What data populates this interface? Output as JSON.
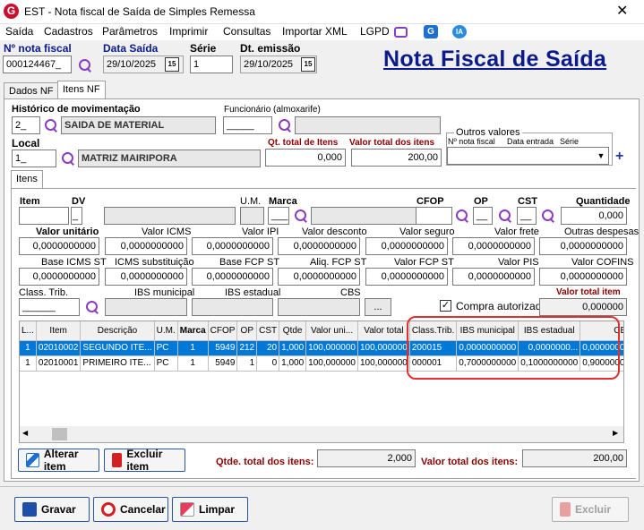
{
  "window": {
    "title": "EST - Nota fiscal de Saída de Simples Remessa",
    "close": "✕"
  },
  "menu": [
    "Saída",
    "Cadastros",
    "Parâmetros",
    "Imprimir",
    "Consultas",
    "Importar XML",
    "LGPD"
  ],
  "menu_icons": {
    "g": "G",
    "ia": "IA"
  },
  "header": {
    "nota_label": "Nº nota fiscal",
    "nota_value": "000124467_",
    "data_saida_label": "Data Saída",
    "data_saida_value": "29/10/2025",
    "serie_label": "Série",
    "serie_value": "1",
    "dt_emissao_label": "Dt. emissão",
    "dt_emissao_value": "29/10/2025",
    "cal_text": "15",
    "big_title": "Nota Fiscal de Saída"
  },
  "tabs": {
    "dados": "Dados NF",
    "itens": "Itens NF",
    "sub": "Itens"
  },
  "top": {
    "hist_label": "Histórico de movimentação",
    "hist_code": "2_",
    "hist_desc": "SAIDA DE MATERIAL",
    "func_label": "Funcionário (almoxarife)",
    "func_code": "_____",
    "local_label": "Local",
    "local_code": "1_",
    "local_desc": "MATRIZ MAIRIPORA",
    "qt_total_label": "Qt. total de Itens",
    "qt_total_value": "0,000",
    "valor_total_label": "Valor total dos itens",
    "valor_total_value": "200,00",
    "outros_label": "Outros valores",
    "outros_nota": "Nº nota fiscal",
    "outros_data": "Data entrada",
    "outros_serie": "Série"
  },
  "item": {
    "item_label": "Item",
    "dv_label": "DV",
    "dv_value": "_",
    "um_label": "U.M.",
    "marca_label": "Marca",
    "marca_value": "___",
    "cfop_label": "CFOP",
    "op_label": "OP",
    "op_value": "__",
    "cst_label": "CST",
    "cst_value": "__",
    "quantidade_label": "Quantidade",
    "quantidade_value": "0,000",
    "valor_unitario_label": "Valor unitário",
    "valor_unitario_value": "0,0000000000",
    "valor_icms_label": "Valor ICMS",
    "valor_icms_value": "0,0000000000",
    "valor_ipi_label": "Valor IPI",
    "valor_ipi_value": "0,0000000000",
    "valor_desconto_label": "Valor desconto",
    "valor_desconto_value": "0,0000000000",
    "valor_seguro_label": "Valor seguro",
    "valor_seguro_value": "0,0000000000",
    "valor_frete_label": "Valor frete",
    "valor_frete_value": "0,0000000000",
    "outras_label": "Outras despesas",
    "outras_value": "0,0000000000",
    "base_icms_st_label": "Base ICMS ST",
    "base_icms_st_value": "0,0000000000",
    "icms_sub_label": "ICMS substituição",
    "icms_sub_value": "0,0000000000",
    "base_fcp_label": "Base FCP ST",
    "base_fcp_value": "0,0000000000",
    "aliq_fcp_label": "Aliq. FCP ST",
    "aliq_fcp_value": "0,0000000000",
    "valor_fcp_label": "Valor FCP ST",
    "valor_fcp_value": "0,0000000000",
    "valor_pis_label": "Valor PIS",
    "valor_pis_value": "0,0000000000",
    "valor_cofins_label": "Valor COFINS",
    "valor_cofins_value": "0,0000000000",
    "class_trib_label": "Class. Trib.",
    "class_trib_value": "______",
    "ibs_mun_label": "IBS municipal",
    "ibs_est_label": "IBS estadual",
    "cbs_label": "CBS",
    "ellipsis": "...",
    "compra_label": "Compra autorizada",
    "check": "✓",
    "valor_total_item_label": "Valor total item",
    "valor_total_item_value": "0,000000"
  },
  "grid": {
    "columns": [
      "L...",
      "Item",
      "Descrição",
      "U.M.",
      "Marca",
      "CFOP",
      "OP",
      "CST",
      "Qtde",
      "Valor uni...",
      "Valor total",
      "Class.Trib.",
      "IBS municipal",
      "IBS estadual",
      "CBS"
    ],
    "rows": [
      [
        "1",
        "02010002",
        "SEGUNDO ITE...",
        "PC",
        "1",
        "5949",
        "212",
        "20",
        "1,000",
        "100,000000",
        "100,000000",
        "200015",
        "0,0000000000",
        "0,0000000...",
        "0,0000000..."
      ],
      [
        "1",
        "02010001",
        "PRIMEIRO ITE...",
        "PC",
        "1",
        "5949",
        "1",
        "0",
        "1,000",
        "100,000000",
        "100,000000",
        "000001",
        "0,7000000000",
        "0,1000000000",
        "0,9000000..."
      ]
    ]
  },
  "bottom": {
    "alterar": "Alterar item",
    "excluir_item": "Excluir item",
    "qtde_total_label": "Qtde. total dos itens:",
    "qtde_total_value": "2,000",
    "valor_total_label": "Valor total dos itens:",
    "valor_total_value": "200,00",
    "gravar": "Gravar",
    "cancelar": "Cancelar",
    "limpar": "Limpar",
    "excluir": "Excluir"
  }
}
